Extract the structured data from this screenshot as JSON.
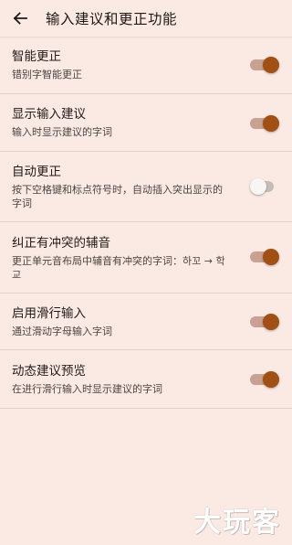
{
  "header": {
    "title": "输入建议和更正功能",
    "back_icon": "arrow-back-icon"
  },
  "colors": {
    "background": "#fbe9e4",
    "accent": "#a14f12",
    "track_on": "#c8a192"
  },
  "settings": [
    {
      "title": "智能更正",
      "subtitle": "错别字智能更正",
      "enabled": true
    },
    {
      "title": "显示输入建议",
      "subtitle": "输入时显示建议的字词",
      "enabled": true
    },
    {
      "title": "自动更正",
      "subtitle": "按下空格键和标点符号时，自动插入突出显示的字词",
      "enabled": false
    },
    {
      "title": "纠正有冲突的辅音",
      "subtitle": "更正单元音布局中辅音有冲突的字词：하꼬 → 학교",
      "enabled": true
    },
    {
      "title": "启用滑行输入",
      "subtitle": "通过滑动字母输入字词",
      "enabled": true
    },
    {
      "title": "动态建议预览",
      "subtitle": "在进行滑行输入时显示建议的字词",
      "enabled": true
    }
  ],
  "watermark": "大玩客"
}
